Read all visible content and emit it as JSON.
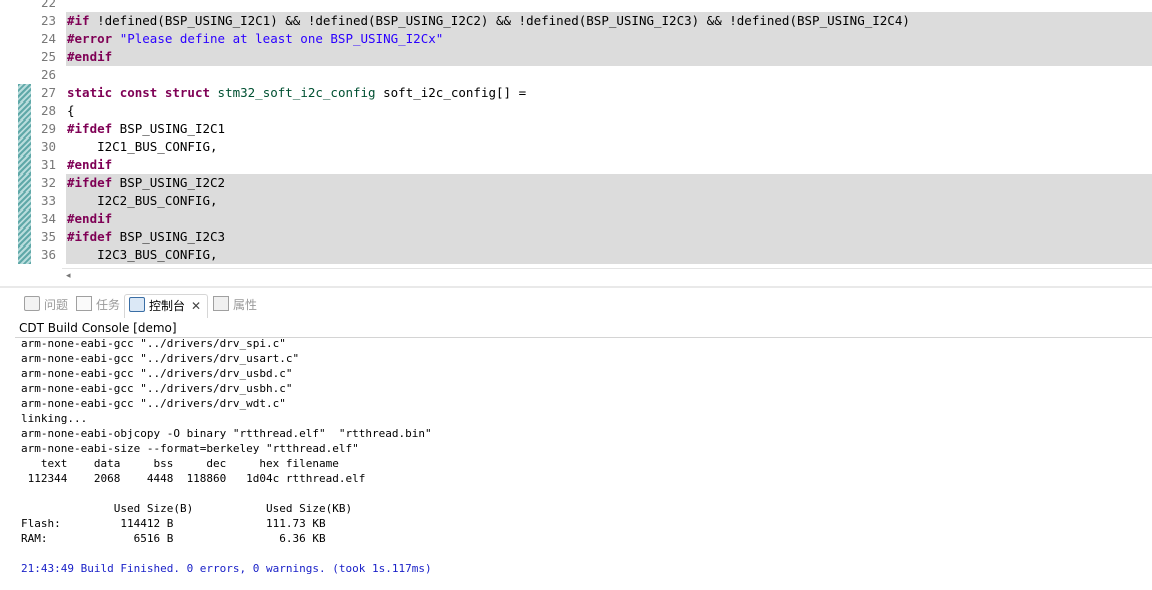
{
  "editor": {
    "lines": [
      {
        "num": "22",
        "hl": false,
        "mod": false,
        "parts": []
      },
      {
        "num": "23",
        "hl": true,
        "mod": false,
        "parts": [
          {
            "t": "#if",
            "c": "kw"
          },
          {
            "t": " !defined(BSP_USING_I2C1) && !defined(BSP_USING_I2C2) && !defined(BSP_USING_I2C3) && !defined(BSP_USING_I2C4)",
            "c": ""
          }
        ]
      },
      {
        "num": "24",
        "hl": true,
        "mod": false,
        "parts": [
          {
            "t": "#error",
            "c": "kw"
          },
          {
            "t": " ",
            "c": ""
          },
          {
            "t": "\"Please define at least one BSP_USING_I2Cx\"",
            "c": "str"
          }
        ]
      },
      {
        "num": "25",
        "hl": true,
        "mod": false,
        "parts": [
          {
            "t": "#endif",
            "c": "kw"
          }
        ]
      },
      {
        "num": "26",
        "hl": false,
        "mod": false,
        "parts": []
      },
      {
        "num": "27",
        "hl": false,
        "mod": true,
        "parts": [
          {
            "t": "static",
            "c": "kw"
          },
          {
            "t": " ",
            "c": ""
          },
          {
            "t": "const",
            "c": "kw"
          },
          {
            "t": " ",
            "c": ""
          },
          {
            "t": "struct",
            "c": "kw"
          },
          {
            "t": " ",
            "c": ""
          },
          {
            "t": "stm32_soft_i2c_config",
            "c": "type"
          },
          {
            "t": " soft_i2c_config[] =",
            "c": ""
          }
        ]
      },
      {
        "num": "28",
        "hl": false,
        "mod": true,
        "parts": [
          {
            "t": "{",
            "c": ""
          }
        ]
      },
      {
        "num": "29",
        "hl": false,
        "mod": true,
        "parts": [
          {
            "t": "#ifdef",
            "c": "kw"
          },
          {
            "t": " BSP_USING_I2C1",
            "c": ""
          }
        ]
      },
      {
        "num": "30",
        "hl": false,
        "mod": true,
        "parts": [
          {
            "t": "    I2C1_BUS_CONFIG,",
            "c": ""
          }
        ]
      },
      {
        "num": "31",
        "hl": false,
        "mod": true,
        "parts": [
          {
            "t": "#endif",
            "c": "kw"
          }
        ]
      },
      {
        "num": "32",
        "hl": true,
        "mod": true,
        "parts": [
          {
            "t": "#ifdef",
            "c": "kw"
          },
          {
            "t": " BSP_USING_I2C2",
            "c": ""
          }
        ]
      },
      {
        "num": "33",
        "hl": true,
        "mod": true,
        "parts": [
          {
            "t": "    I2C2_BUS_CONFIG,",
            "c": ""
          }
        ]
      },
      {
        "num": "34",
        "hl": true,
        "mod": true,
        "parts": [
          {
            "t": "#endif",
            "c": "kw"
          }
        ]
      },
      {
        "num": "35",
        "hl": true,
        "mod": true,
        "parts": [
          {
            "t": "#ifdef",
            "c": "kw"
          },
          {
            "t": " BSP_USING_I2C3",
            "c": ""
          }
        ]
      },
      {
        "num": "36",
        "hl": true,
        "mod": true,
        "parts": [
          {
            "t": "    I2C3_BUS_CONFIG,",
            "c": ""
          }
        ]
      }
    ],
    "hscroll_arrow": "◂"
  },
  "tabs": [
    {
      "id": "problems",
      "label": "问题",
      "icon": "problems-icon",
      "active": false
    },
    {
      "id": "tasks",
      "label": "任务",
      "icon": "tasks-icon",
      "active": false
    },
    {
      "id": "console",
      "label": "控制台",
      "icon": "console-icon",
      "active": true,
      "close": "✕"
    },
    {
      "id": "properties",
      "label": "属性",
      "icon": "properties-icon",
      "active": false
    }
  ],
  "console": {
    "title": "CDT Build Console [demo]",
    "lines": [
      {
        "text": "arm-none-eabi-gcc \"../drivers/drv_spi.c\"",
        "type": "normal"
      },
      {
        "text": "arm-none-eabi-gcc \"../drivers/drv_usart.c\"",
        "type": "normal"
      },
      {
        "text": "arm-none-eabi-gcc \"../drivers/drv_usbd.c\"",
        "type": "normal"
      },
      {
        "text": "arm-none-eabi-gcc \"../drivers/drv_usbh.c\"",
        "type": "normal"
      },
      {
        "text": "arm-none-eabi-gcc \"../drivers/drv_wdt.c\"",
        "type": "normal"
      },
      {
        "text": "linking...",
        "type": "normal"
      },
      {
        "text": "arm-none-eabi-objcopy -O binary \"rtthread.elf\"  \"rtthread.bin\"",
        "type": "normal"
      },
      {
        "text": "arm-none-eabi-size --format=berkeley \"rtthread.elf\"",
        "type": "normal"
      },
      {
        "text": "   text    data     bss     dec     hex filename",
        "type": "normal"
      },
      {
        "text": " 112344    2068    4448  118860   1d04c rtthread.elf",
        "type": "normal"
      },
      {
        "text": "",
        "type": "normal"
      },
      {
        "text": "              Used Size(B)           Used Size(KB)",
        "type": "normal"
      },
      {
        "text": "Flash:         114412 B              111.73 KB",
        "type": "normal"
      },
      {
        "text": "RAM:             6516 B                6.36 KB",
        "type": "normal"
      },
      {
        "text": "",
        "type": "normal"
      },
      {
        "text": "21:43:49 Build Finished. 0 errors, 0 warnings. (took 1s.117ms)",
        "type": "info"
      }
    ]
  },
  "colors": {
    "keyword": "#7f0055",
    "string": "#2a00ff",
    "type": "#005032",
    "highlight": "#dcdcdc",
    "console_info": "#1b22c8"
  }
}
